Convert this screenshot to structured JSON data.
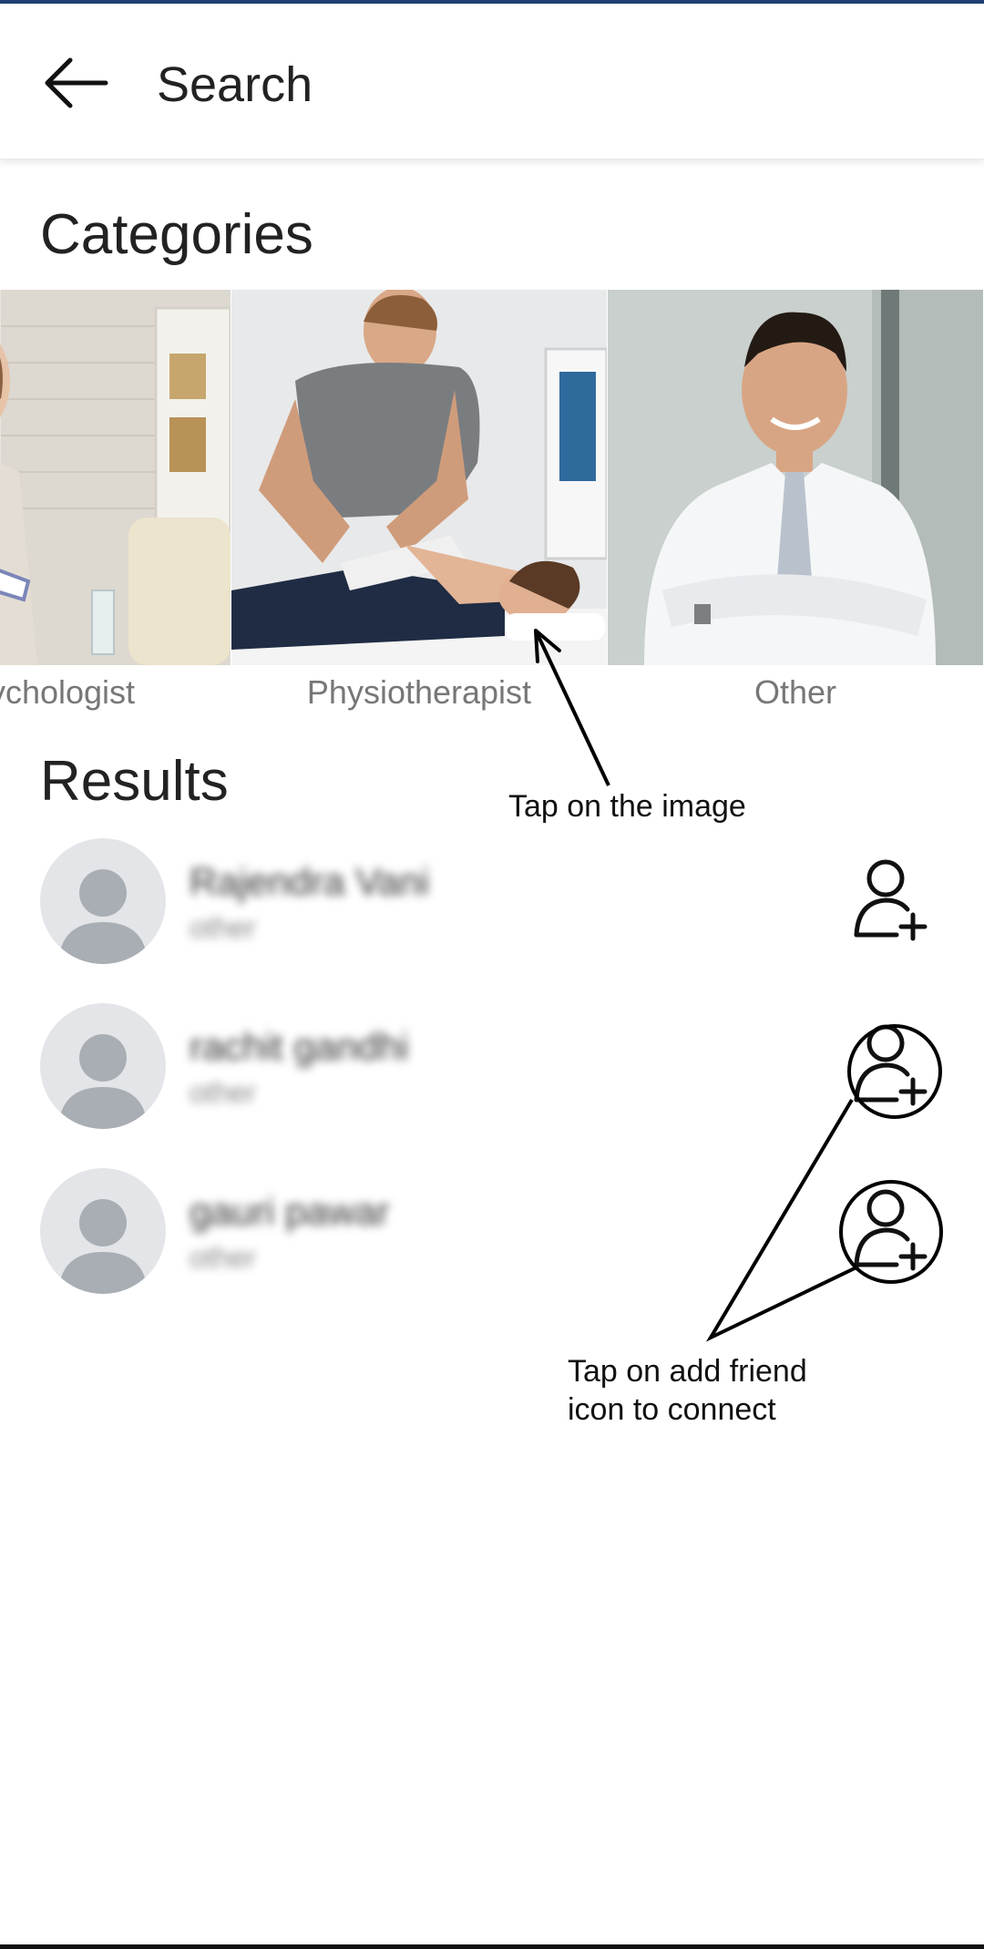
{
  "header": {
    "title": "Search",
    "back_icon": "arrow-left-icon"
  },
  "categories_title": "Categories",
  "categories": [
    {
      "label": "Psychologist",
      "visible_label": "chologist"
    },
    {
      "label": "Physiotherapist"
    },
    {
      "label": "Other"
    }
  ],
  "results_title": "Results",
  "results": [
    {
      "name": "Rajendra Vani",
      "category": "other"
    },
    {
      "name": "rachit gandhi",
      "category": "other"
    },
    {
      "name": "gauri pawar",
      "category": "other"
    }
  ],
  "annotations": {
    "tap_image": "Tap on the image",
    "tap_add_line1": "Tap on add friend",
    "tap_add_line2": "icon to connect"
  },
  "colors": {
    "accent_strip": "#1f3f73",
    "avatar_bg": "#e3e5e8",
    "avatar_fg": "#a9aeb4",
    "label_gray": "#777777"
  }
}
